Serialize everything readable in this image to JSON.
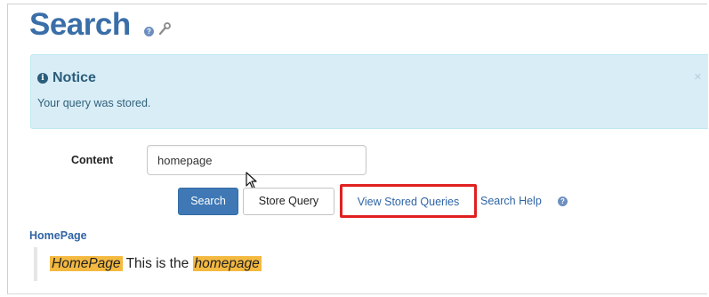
{
  "header": {
    "title": "Search",
    "help_icon": "question-circle-icon",
    "wrench_icon": "wrench-icon"
  },
  "notice": {
    "icon": "info-circle-icon",
    "icon_glyph": "i",
    "title": "Notice",
    "message": "Your query was stored.",
    "close_label": "×"
  },
  "form": {
    "content_label": "Content",
    "content_value": "homepage",
    "buttons": {
      "search": "Search",
      "store_query": "Store Query",
      "view_stored": "View Stored Queries"
    },
    "search_help": "Search Help",
    "search_help_icon": "question-circle-icon"
  },
  "results": [
    {
      "title": "HomePage",
      "snippet_hl1": "HomePage",
      "snippet_mid": " This is the ",
      "snippet_hl2": "homepage"
    }
  ],
  "colors": {
    "accent": "#3a6ea8",
    "notice_bg": "#d9edf7",
    "highlight": "#f4b940",
    "callout_red": "#e02020"
  }
}
